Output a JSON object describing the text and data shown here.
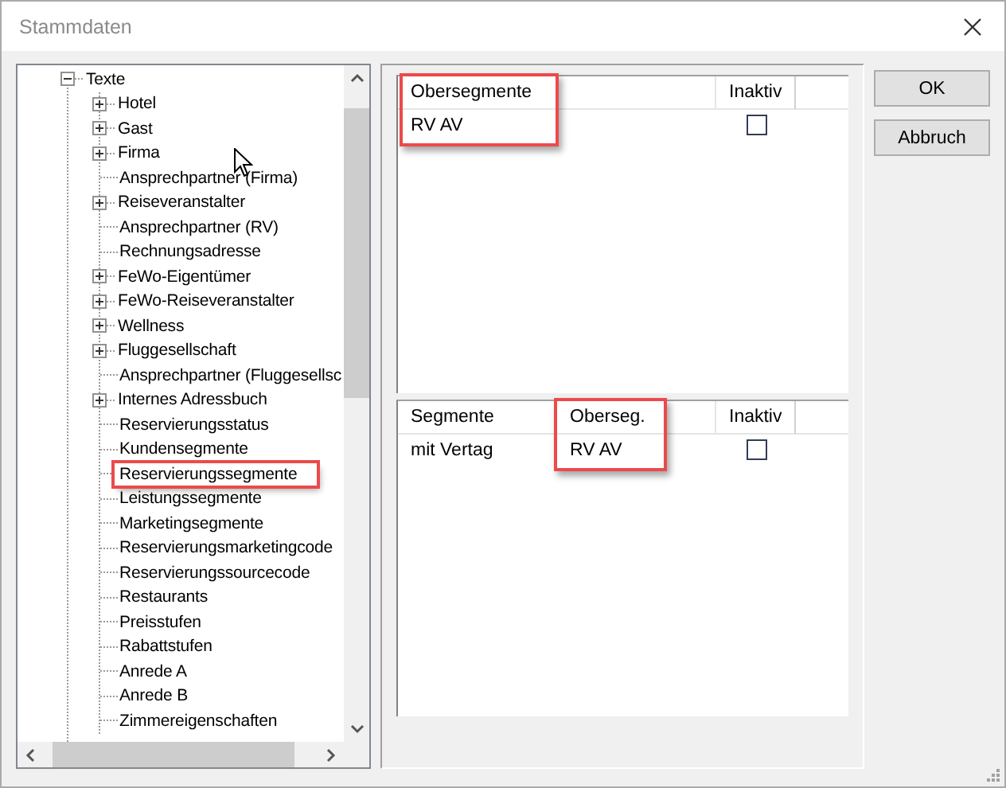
{
  "window": {
    "title": "Stammdaten"
  },
  "tree": {
    "items": [
      {
        "label": "Texte",
        "kind": "folder",
        "expanded": true,
        "highlighted": false,
        "children": [
          {
            "label": "Hotel",
            "kind": "folder",
            "expanded": false,
            "highlighted": false
          },
          {
            "label": "Gast",
            "kind": "folder",
            "expanded": false,
            "highlighted": false
          },
          {
            "label": "Firma",
            "kind": "folder",
            "expanded": false,
            "highlighted": false
          },
          {
            "label": "Ansprechpartner (Firma)",
            "kind": "leaf",
            "highlighted": false
          },
          {
            "label": "Reiseveranstalter",
            "kind": "folder",
            "expanded": false,
            "highlighted": false
          },
          {
            "label": "Ansprechpartner (RV)",
            "kind": "leaf",
            "highlighted": false
          },
          {
            "label": "Rechnungsadresse",
            "kind": "leaf",
            "highlighted": false
          },
          {
            "label": "FeWo-Eigentümer",
            "kind": "folder",
            "expanded": false,
            "highlighted": false
          },
          {
            "label": "FeWo-Reiseveranstalter",
            "kind": "folder",
            "expanded": false,
            "highlighted": false
          },
          {
            "label": "Wellness",
            "kind": "folder",
            "expanded": false,
            "highlighted": false
          },
          {
            "label": "Fluggesellschaft",
            "kind": "folder",
            "expanded": false,
            "highlighted": false
          },
          {
            "label": "Ansprechpartner (Fluggesellsc",
            "kind": "leaf",
            "highlighted": false
          },
          {
            "label": "Internes Adressbuch",
            "kind": "folder",
            "expanded": false,
            "highlighted": false
          },
          {
            "label": "Reservierungsstatus",
            "kind": "leaf",
            "highlighted": false
          },
          {
            "label": "Kundensegmente",
            "kind": "leaf",
            "highlighted": false
          },
          {
            "label": "Reservierungssegmente",
            "kind": "leaf",
            "highlighted": true
          },
          {
            "label": "Leistungssegmente",
            "kind": "leaf",
            "highlighted": false
          },
          {
            "label": "Marketingsegmente",
            "kind": "leaf",
            "highlighted": false
          },
          {
            "label": "Reservierungsmarketingcode",
            "kind": "leaf",
            "highlighted": false
          },
          {
            "label": "Reservierungssourcecode",
            "kind": "leaf",
            "highlighted": false
          },
          {
            "label": "Restaurants",
            "kind": "leaf",
            "highlighted": false
          },
          {
            "label": "Preisstufen",
            "kind": "leaf",
            "highlighted": false
          },
          {
            "label": "Rabattstufen",
            "kind": "leaf",
            "highlighted": false
          },
          {
            "label": "Anrede A",
            "kind": "leaf",
            "highlighted": false
          },
          {
            "label": "Anrede B",
            "kind": "leaf",
            "highlighted": false
          },
          {
            "label": "Zimmereigenschaften",
            "kind": "leaf",
            "highlighted": false
          }
        ]
      }
    ]
  },
  "lists": [
    {
      "columns": [
        {
          "label": "Obersegmente",
          "kind": "text",
          "highlighted": true
        },
        {
          "label": "Inaktiv",
          "kind": "checkbox",
          "highlighted": false
        }
      ],
      "rows": [
        {
          "cells": [
            {
              "text": "RV AV"
            },
            {
              "checked": false
            }
          ]
        }
      ]
    },
    {
      "columns": [
        {
          "label": "Segmente",
          "kind": "text",
          "highlighted": false
        },
        {
          "label": "Oberseg.",
          "kind": "text",
          "highlighted": true
        },
        {
          "label": "Inaktiv",
          "kind": "checkbox",
          "highlighted": false
        }
      ],
      "rows": [
        {
          "cells": [
            {
              "text": "mit Vertag"
            },
            {
              "text": "RV AV"
            },
            {
              "checked": false
            }
          ]
        }
      ]
    }
  ],
  "buttons": [
    {
      "label": "OK"
    },
    {
      "label": "Abbruch"
    }
  ]
}
